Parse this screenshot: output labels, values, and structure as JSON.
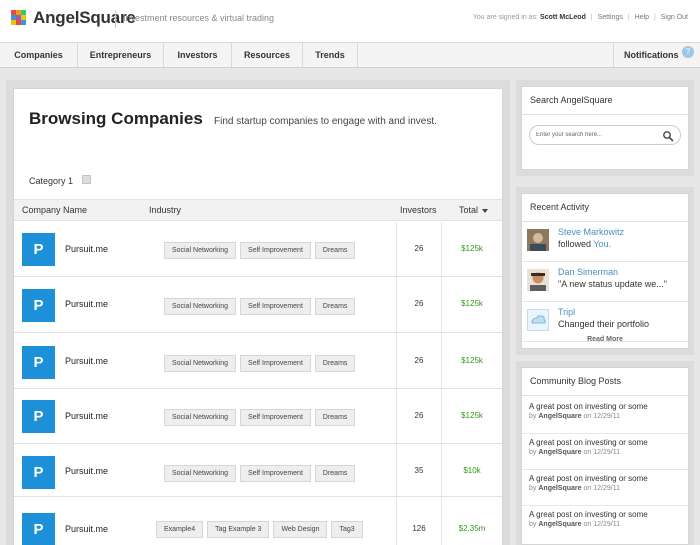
{
  "header": {
    "brand": "AngelSquare",
    "tagline": "Investment resources & virtual trading",
    "signed_in_prefix": "You are signed in as:",
    "user_name": "Scott McLeod",
    "settings": "Settings",
    "help": "Help",
    "sign_out": "Sign Out",
    "logo_colors": [
      "#e84c3d",
      "#f39c12",
      "#2ecc71",
      "#3498db",
      "#9b59b6",
      "#f1c40f"
    ]
  },
  "nav": {
    "items": [
      {
        "label": "Companies"
      },
      {
        "label": "Entrepreneurs"
      },
      {
        "label": "Investors"
      },
      {
        "label": "Resources"
      },
      {
        "label": "Trends"
      }
    ],
    "notifications": "Notifications",
    "notifications_badge": "?"
  },
  "main": {
    "title": "Browsing Companies",
    "subtitle": "Find startup companies to engage with and invest.",
    "category_label": "Category 1",
    "columns": {
      "company": "Company Name",
      "industry": "Industry",
      "investors": "Investors",
      "total": "Total"
    },
    "rows": [
      {
        "initial": "P",
        "name": "Pursuit.me",
        "tags": [
          "Social Networking",
          "Self Improvement",
          "Dreams"
        ],
        "investors": "26",
        "total": "$125k"
      },
      {
        "initial": "P",
        "name": "Pursuit.me",
        "tags": [
          "Social Networking",
          "Self Improvement",
          "Dreams"
        ],
        "investors": "26",
        "total": "$125k"
      },
      {
        "initial": "P",
        "name": "Pursuit.me",
        "tags": [
          "Social Networking",
          "Self Improvement",
          "Dreams"
        ],
        "investors": "26",
        "total": "$125k"
      },
      {
        "initial": "P",
        "name": "Pursuit.me",
        "tags": [
          "Social Networking",
          "Self Improvement",
          "Dreams"
        ],
        "investors": "26",
        "total": "$125k"
      },
      {
        "initial": "P",
        "name": "Pursuit.me",
        "tags": [
          "Social Networking",
          "Self Improvement",
          "Dreams"
        ],
        "investors": "35",
        "total": "$10k"
      },
      {
        "initial": "P",
        "name": "Pursuit.me",
        "tags": [
          "Example4",
          "Tag Example 3",
          "Web Design",
          "Tag3"
        ],
        "investors": "126",
        "total": "$2.35m"
      }
    ]
  },
  "sidebar": {
    "search": {
      "title": "Search AngelSquare",
      "placeholder": "Enter your search here..."
    },
    "activity": {
      "title": "Recent Activity",
      "items": [
        {
          "name": "Steve Markowitz",
          "text": "followed ",
          "highlight": "You."
        },
        {
          "name": "Dan Simerman",
          "text": "\"A new status update we...\"",
          "highlight": ""
        },
        {
          "name": "Tripl",
          "text": "Changed their portfolio",
          "highlight": ""
        }
      ],
      "read_more": "Read More"
    },
    "blog": {
      "title": "Community Blog Posts",
      "items": [
        {
          "title": "A great post on investing or some",
          "by": "by",
          "author": "AngelSquare",
          "on": "on 12/29/11"
        },
        {
          "title": "A great post on investing or some",
          "by": "by",
          "author": "AngelSquare",
          "on": "on 12/29/11"
        },
        {
          "title": "A great post on investing or some",
          "by": "by",
          "author": "AngelSquare",
          "on": "on 12/29/11"
        },
        {
          "title": "A great post on investing or some",
          "by": "by",
          "author": "AngelSquare",
          "on": "on 12/29/11"
        }
      ]
    }
  },
  "colors": {
    "accent_blue": "#1e90d8",
    "link_blue": "#4a8fc4",
    "money_green": "#2e9b1b"
  }
}
